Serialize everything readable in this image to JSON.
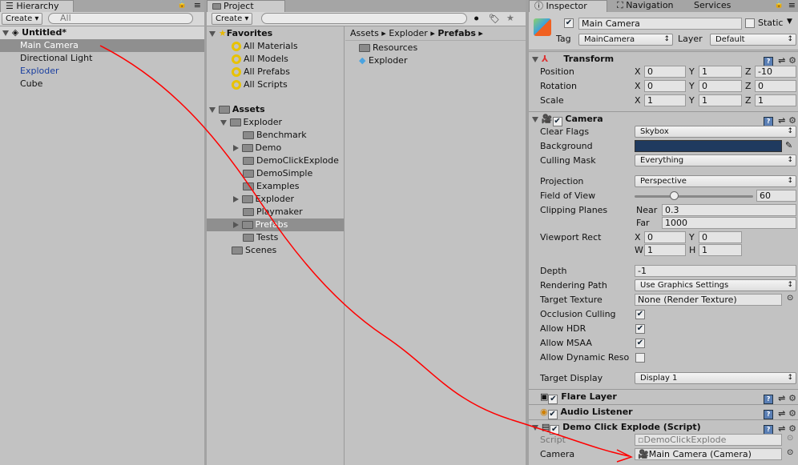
{
  "hierarchy": {
    "tab": "Hierarchy",
    "create": "Create",
    "search_placeholder": "All",
    "scene": "Untitled*",
    "items": [
      "Main Camera",
      "Directional Light",
      "Exploder",
      "Cube"
    ]
  },
  "project": {
    "tab": "Project",
    "create": "Create",
    "favorites": "Favorites",
    "fav_items": [
      "All Materials",
      "All Models",
      "All Prefabs",
      "All Scripts"
    ],
    "assets": "Assets",
    "tree": [
      "Exploder",
      "Benchmark",
      "Demo",
      "DemoClickExplode",
      "DemoSimple",
      "Examples",
      "Exploder",
      "Playmaker",
      "Prefabs",
      "Tests",
      "Scenes"
    ],
    "breadcrumb": [
      "Assets",
      "Exploder",
      "Prefabs"
    ],
    "files": [
      "Resources",
      "Exploder"
    ]
  },
  "inspector": {
    "tabs": [
      "Inspector",
      "Navigation",
      "Services"
    ],
    "object_name": "Main Camera",
    "static_label": "Static",
    "tag_label": "Tag",
    "tag": "MainCamera",
    "layer_label": "Layer",
    "layer": "Default",
    "transform": {
      "title": "Transform",
      "rows": [
        {
          "label": "Position",
          "x": "0",
          "y": "1",
          "z": "-10"
        },
        {
          "label": "Rotation",
          "x": "0",
          "y": "0",
          "z": "0"
        },
        {
          "label": "Scale",
          "x": "1",
          "y": "1",
          "z": "1"
        }
      ]
    },
    "camera": {
      "title": "Camera",
      "clear_flags_label": "Clear Flags",
      "clear_flags": "Skybox",
      "background_label": "Background",
      "background_color": "#1f3a5f",
      "culling_label": "Culling Mask",
      "culling": "Everything",
      "projection_label": "Projection",
      "projection": "Perspective",
      "fov_label": "Field of View",
      "fov": "60",
      "fov_fraction": 0.33,
      "clipping_label": "Clipping Planes",
      "near_label": "Near",
      "near": "0.3",
      "far_label": "Far",
      "far": "1000",
      "viewport_label": "Viewport Rect",
      "vx": "0",
      "vy": "0",
      "vw": "1",
      "vh": "1",
      "depth_label": "Depth",
      "depth": "-1",
      "render_path_label": "Rendering Path",
      "render_path": "Use Graphics Settings",
      "target_tex_label": "Target Texture",
      "target_tex": "None (Render Texture)",
      "occlusion_label": "Occlusion Culling",
      "hdr_label": "Allow HDR",
      "msaa_label": "Allow MSAA",
      "dyn_label": "Allow Dynamic Reso",
      "display_label": "Target Display",
      "display": "Display 1"
    },
    "flare": "Flare Layer",
    "audio": "Audio Listener",
    "script_comp": {
      "title": "Demo Click Explode (Script)",
      "script_label": "Script",
      "script": "DemoClickExplode",
      "camera_label": "Camera",
      "camera": "Main Camera (Camera)"
    }
  },
  "annotation_color": "#ff0000"
}
